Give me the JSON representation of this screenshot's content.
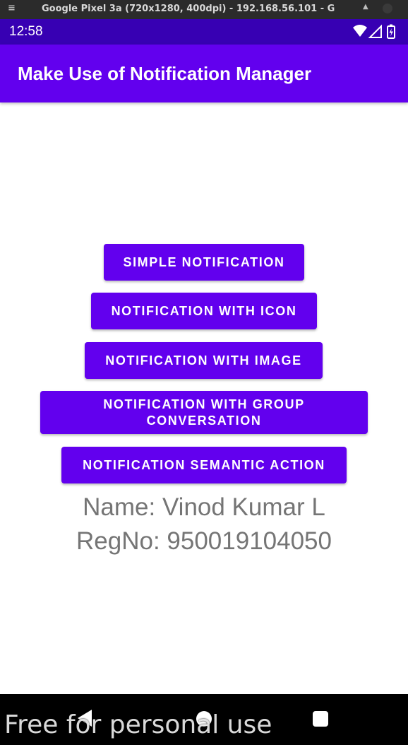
{
  "emulator": {
    "menu_icon": "hamburger-icon",
    "title": "Google Pixel 3a (720x1280, 400dpi) - 192.168.56.101 - G"
  },
  "status_bar": {
    "time": "12:58",
    "icons": [
      "wifi-icon",
      "signal-icon",
      "battery-icon"
    ]
  },
  "app_bar": {
    "title": "Make Use of Notification Manager"
  },
  "buttons": {
    "simple": "SIMPLE NOTIFICATION",
    "icon": "NOTIFICATION WITH ICON",
    "image": "NOTIFICATION WITH IMAGE",
    "group": "NOTIFICATION WITH GROUP CONVERSATION",
    "semantic": "NOTIFICATION SEMANTIC ACTION"
  },
  "info": {
    "name": "Name: Vinod Kumar L",
    "regno": "RegNo: 950019104050"
  },
  "nav_bar": {
    "icons": [
      "back-icon",
      "home-icon",
      "recents-icon"
    ]
  },
  "watermark": "Free for personal use",
  "colors": {
    "primary": "#6200ee",
    "primary_dark": "#3700b3",
    "info_text": "#757575"
  }
}
